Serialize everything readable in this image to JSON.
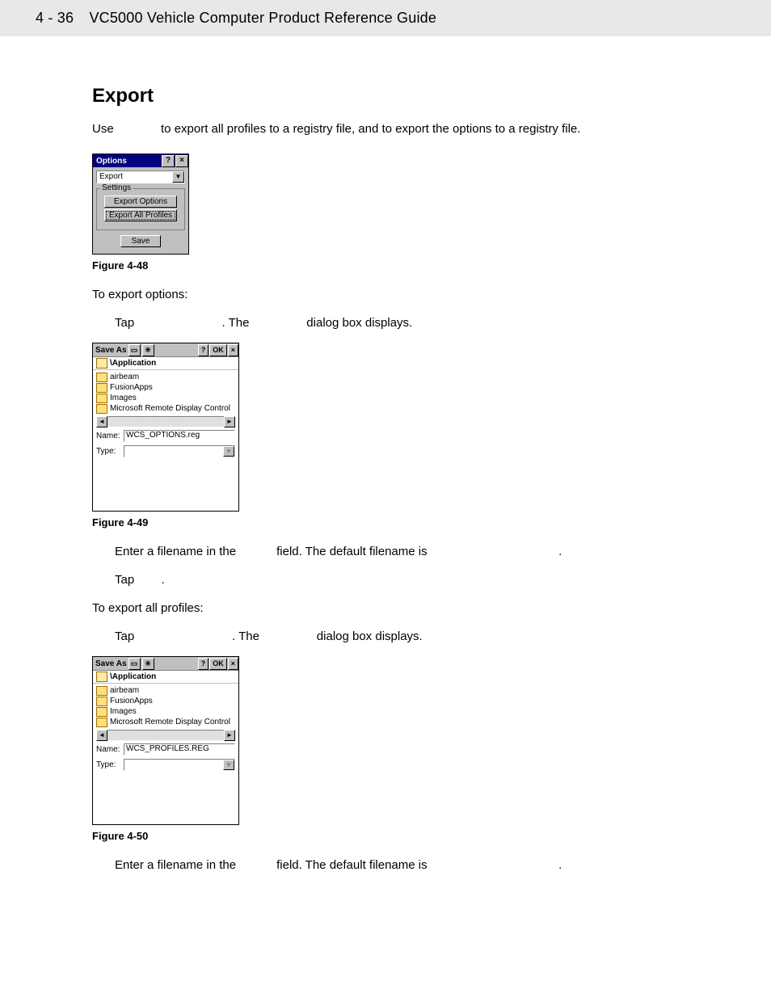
{
  "header": {
    "page_number": "4 - 36",
    "title": "VC5000 Vehicle Computer Product Reference Guide"
  },
  "section_heading": "Export",
  "intro": "Use              to export all profiles to a registry file, and to export the options to a registry file.",
  "options_dialog": {
    "title": "Options",
    "dropdown": "Export",
    "group_label": "Settings",
    "btn_export_options": "Export Options",
    "btn_export_all": "Export All Profiles",
    "save": "Save"
  },
  "fig48": "Figure 4-48",
  "to_export_options": "To export options:",
  "step_tap_options": "Tap                          . The                 dialog box displays.",
  "saveas": {
    "title": "Save As",
    "path": "\\Application",
    "folders": [
      "airbeam",
      "FusionApps",
      "Images",
      "Microsoft Remote Display Control"
    ],
    "name_label": "Name:",
    "type_label": "Type:",
    "ok": "OK",
    "help": "?",
    "close": "×"
  },
  "name_options": "WCS_OPTIONS.reg",
  "fig49": "Figure 4-49",
  "step_enter_name": "Enter a filename in the            field. The default filename is                                       .",
  "step_tap_ok": "Tap        .",
  "to_export_profiles": "To export all profiles:",
  "step_tap_profiles": "Tap                             . The                 dialog box displays.",
  "name_profiles": "WCS_PROFILES.REG",
  "fig50": "Figure 4-50",
  "step_enter_name2": "Enter a filename in the            field. The default filename is                                       ."
}
